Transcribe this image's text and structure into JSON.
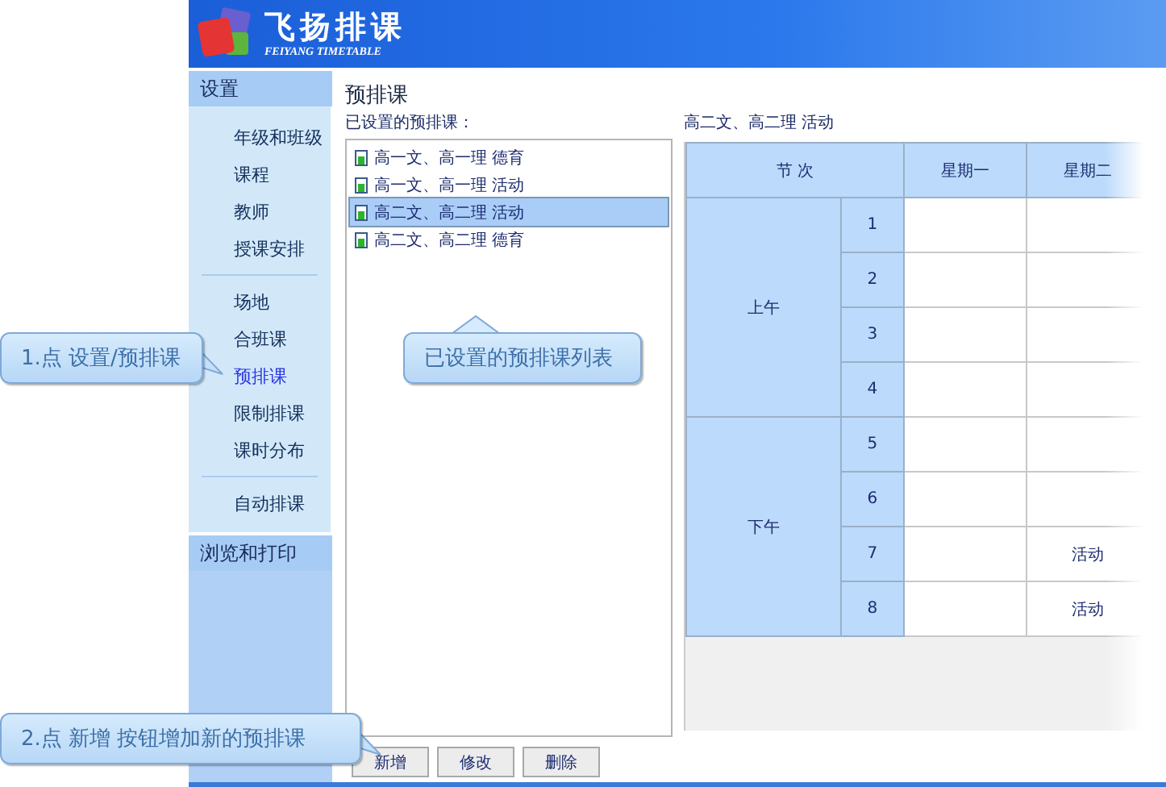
{
  "app": {
    "logo_title": "飞扬排课",
    "logo_subtitle": "FEIYANG TIMETABLE"
  },
  "sidebar": {
    "sections": [
      {
        "label": "设置",
        "expanded": true,
        "groups": [
          {
            "items": [
              {
                "label": "年级和班级",
                "selected": false
              },
              {
                "label": "课程",
                "selected": false
              },
              {
                "label": "教师",
                "selected": false
              },
              {
                "label": "授课安排",
                "selected": false
              }
            ]
          },
          {
            "items": [
              {
                "label": "场地",
                "selected": false
              },
              {
                "label": "合班课",
                "selected": false
              },
              {
                "label": "预排课",
                "selected": true
              },
              {
                "label": "限制排课",
                "selected": false
              },
              {
                "label": "课时分布",
                "selected": false
              }
            ]
          },
          {
            "items": [
              {
                "label": "自动排课",
                "selected": false
              }
            ]
          }
        ]
      },
      {
        "label": "浏览和打印",
        "expanded": false
      }
    ]
  },
  "page_title": "预排课",
  "list": {
    "label": "已设置的预排课：",
    "items": [
      {
        "text": "高一文、高一理 德育",
        "selected": false
      },
      {
        "text": "高一文、高一理 活动",
        "selected": false
      },
      {
        "text": "高二文、高二理 活动",
        "selected": true
      },
      {
        "text": "高二文、高二理 德育",
        "selected": false
      }
    ]
  },
  "schedule": {
    "title": "高二文、高二理 活动",
    "header": "节 次",
    "days": [
      "星期一",
      "星期二"
    ],
    "periods": [
      {
        "label": "上午",
        "rows": [
          {
            "number": "1",
            "cells": [
              null,
              null
            ]
          },
          {
            "number": "2",
            "cells": [
              null,
              null
            ]
          },
          {
            "number": "3",
            "cells": [
              null,
              null
            ]
          },
          {
            "number": "4",
            "cells": [
              null,
              null
            ]
          }
        ]
      },
      {
        "label": "下午",
        "rows": [
          {
            "number": "5",
            "cells": [
              null,
              null
            ]
          },
          {
            "number": "6",
            "cells": [
              null,
              null
            ]
          },
          {
            "number": "7",
            "cells": [
              null,
              "活动"
            ]
          },
          {
            "number": "8",
            "cells": [
              null,
              "活动"
            ]
          }
        ]
      }
    ]
  },
  "buttons": [
    "新增",
    "修改",
    "删除"
  ],
  "callouts": [
    {
      "text": "1.点 设置/预排课",
      "kind": "pointer-right"
    },
    {
      "text": "已设置的预排课列表",
      "kind": "pointer-up"
    },
    {
      "text": "2.点 新增 按钮增加新的预排课",
      "kind": "pointer-right"
    }
  ]
}
